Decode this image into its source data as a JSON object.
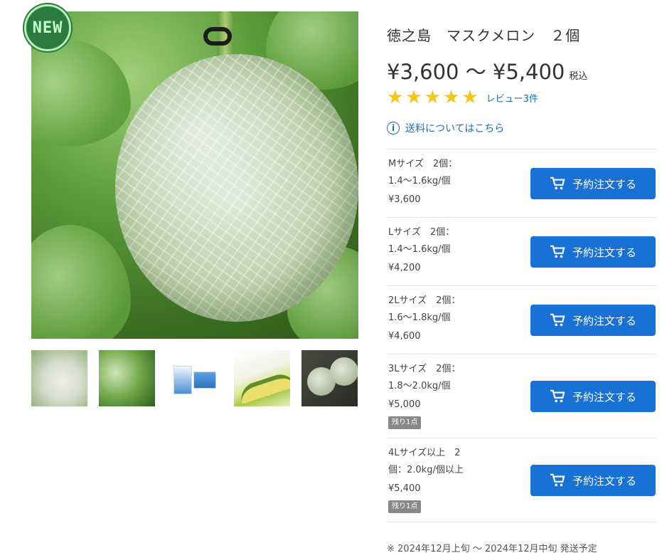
{
  "badge": {
    "label": "NEW"
  },
  "product": {
    "title": "徳之島　マスクメロン　２個",
    "price_range": "¥3,600 〜 ¥5,400",
    "tax_label": "税込",
    "rating_stars": 5,
    "review_link": "レビュー3件",
    "shipping_link": "送料についてはこちら"
  },
  "variants": [
    {
      "line1": "Mサイズ　2個：",
      "line2": "1.4〜1.6kg/個",
      "price": "¥3,600",
      "stock": "",
      "button": "予約注文する"
    },
    {
      "line1": "Lサイズ　2個：",
      "line2": "1.4〜1.6kg/個",
      "price": "¥4,200",
      "stock": "",
      "button": "予約注文する"
    },
    {
      "line1": "2Lサイズ　2個：",
      "line2": "1.6〜1.8kg/個",
      "price": "¥4,600",
      "stock": "",
      "button": "予約注文する"
    },
    {
      "line1": "3Lサイズ　2個：",
      "line2": "1.8〜2.0kg/個",
      "price": "¥5,000",
      "stock": "残り1点",
      "button": "予約注文する"
    },
    {
      "line1": "4Lサイズ以上　2",
      "line2": "個：2.0kg/個以上",
      "price": "¥5,400",
      "stock": "残り1点",
      "button": "予約注文する"
    }
  ],
  "shipping_note": "※ 2024年12月上旬 〜 2024年12月中旬 発送予定",
  "colors": {
    "button": "#1872d6",
    "link": "#1a6fb8",
    "star": "#f5c518",
    "badge": "#2b7a3f"
  }
}
